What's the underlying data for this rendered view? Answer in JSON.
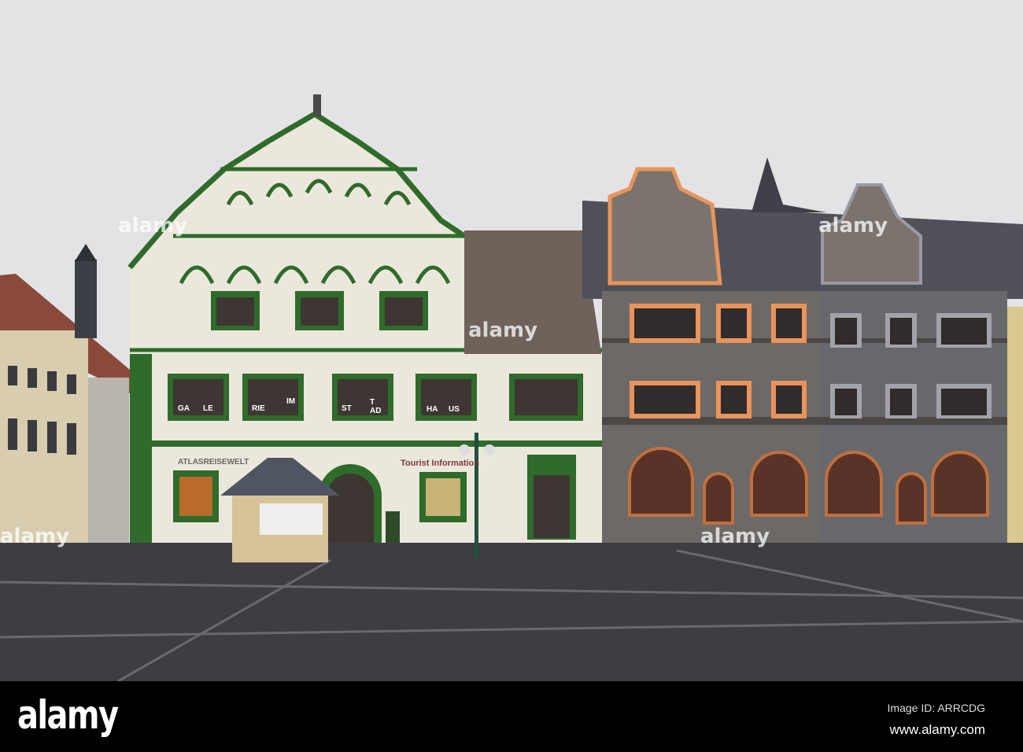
{
  "watermark": {
    "brand": "alamy",
    "text": "alamy"
  },
  "footer": {
    "logo": "alamy",
    "image_id": "Image ID: ARRCDG",
    "url": "www.alamy.com"
  },
  "signs": {
    "atlas": "ATLASREISEWELT",
    "tourist": "Tourist Information",
    "window_letters": [
      "GA",
      "LE",
      "RIE",
      "IM",
      "ST",
      "T AD",
      "HA",
      "US"
    ]
  },
  "colors": {
    "sky": "#e3e3e5",
    "ground": "#3e3d41",
    "green": "#2f6b2a",
    "cream": "#ece7dc",
    "grey_facade": "#6d6966",
    "orange": "#e8945c"
  }
}
